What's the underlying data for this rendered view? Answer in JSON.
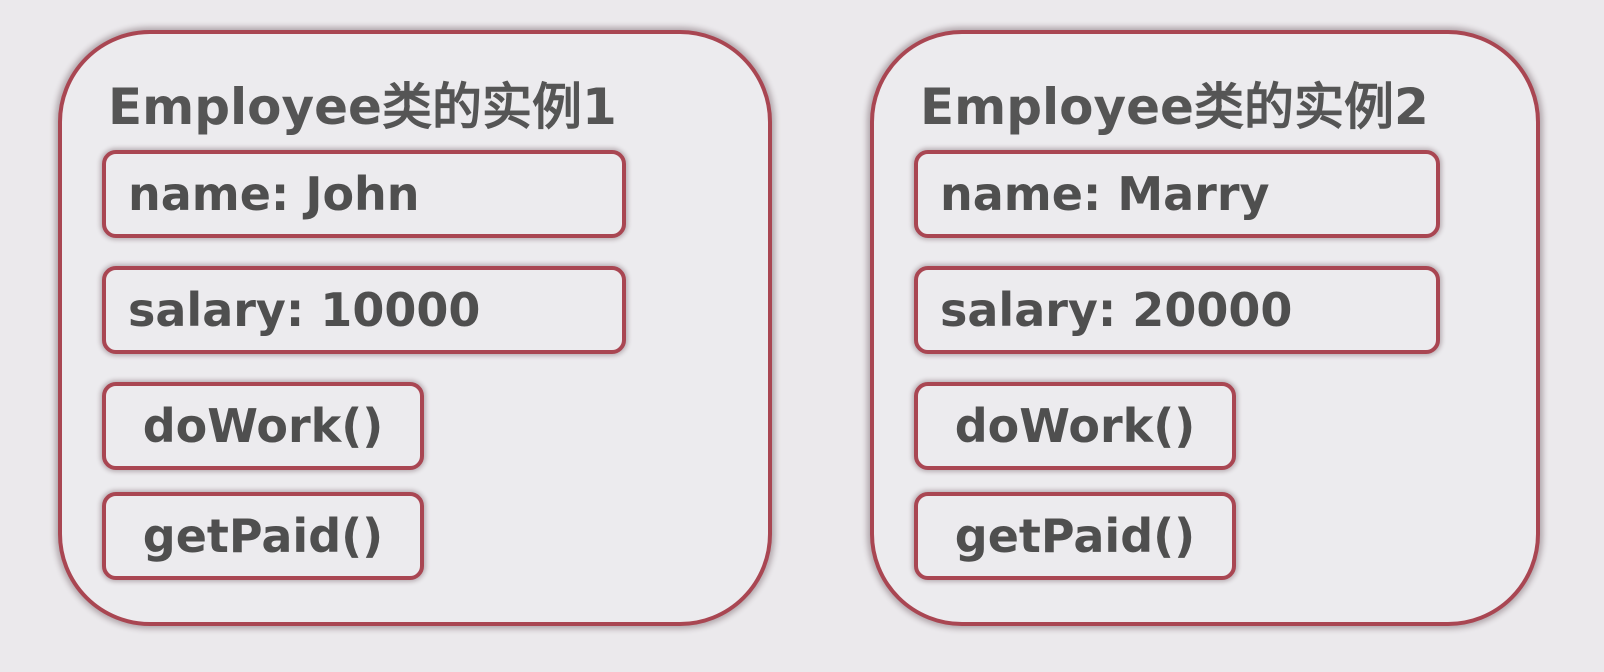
{
  "diagram": {
    "instances": [
      {
        "title": "Employee类的实例1",
        "fields": [
          "name: John",
          "salary: 10000"
        ],
        "methods": [
          "doWork()",
          "getPaid()"
        ]
      },
      {
        "title": "Employee类的实例2",
        "fields": [
          "name: Marry",
          "salary: 20000"
        ],
        "methods": [
          "doWork()",
          "getPaid()"
        ]
      }
    ],
    "colors": {
      "background": "#ebe9ec",
      "border": "#a94652",
      "text": "#4f4f4f"
    }
  }
}
